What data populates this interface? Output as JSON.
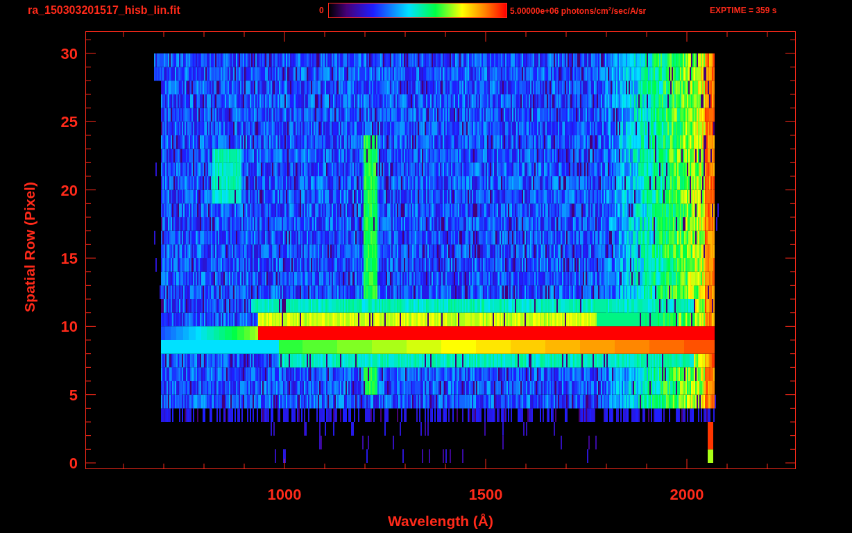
{
  "header": {
    "title": "ra_150303201517_hisb_lin.fit",
    "colorbar": {
      "min_label": "0",
      "max_label": "5.00000e+06 photons/cm$^{2}$/sec/A/sr"
    },
    "exposure": "EXPTIME = 359 s"
  },
  "plot": {
    "xlabel": "Wavelength (Å)",
    "ylabel": "Spatial Row (Pixel)",
    "xticks": [
      "1000",
      "1500",
      "2000"
    ],
    "yticks": [
      "30",
      "25",
      "20",
      "15",
      "10",
      "5",
      "0"
    ]
  }
}
